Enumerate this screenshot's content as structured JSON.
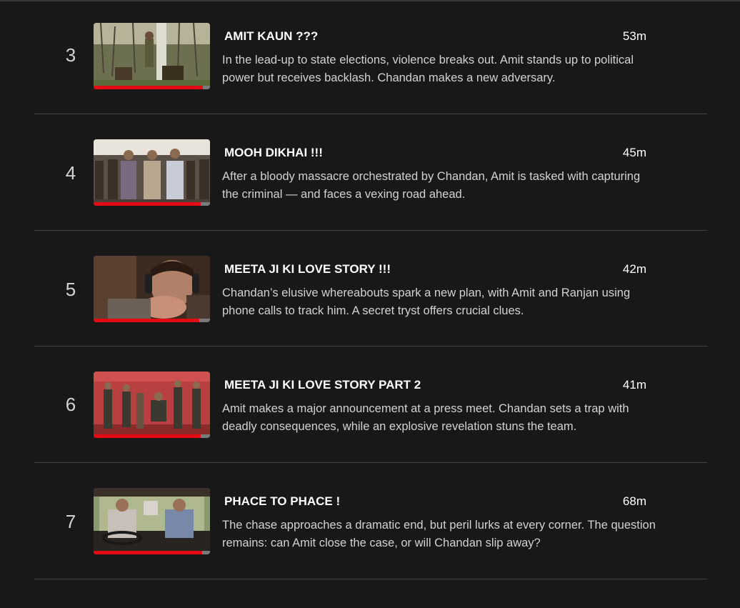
{
  "episodes": [
    {
      "number": "3",
      "title": "AMIT KAUN ???",
      "duration": "53m",
      "description": "In the lead-up to state elections, violence breaks out. Amit stands up to political power but receives backlash. Chandan makes a new adversary.",
      "progress": 0.94,
      "thumb_scene": "forest-pole"
    },
    {
      "number": "4",
      "title": "MOOH DIKHAI !!!",
      "duration": "45m",
      "description": "After a bloody massacre orchestrated by Chandan, Amit is tasked with capturing the criminal — and faces a vexing road ahead.",
      "progress": 0.92,
      "thumb_scene": "crowd-officers"
    },
    {
      "number": "5",
      "title": "MEETA JI KI LOVE STORY !!!",
      "duration": "42m",
      "description": "Chandan’s elusive whereabouts spark a new plan, with Amit and Ranjan using phone calls to track him. A secret tryst offers crucial clues.",
      "progress": 0.91,
      "thumb_scene": "headphones-man"
    },
    {
      "number": "6",
      "title": "MEETA JI KI LOVE STORY PART 2",
      "duration": "41m",
      "description": "Amit makes a major announcement at a press meet. Chandan sets a trap with deadly consequences, while an explosive revelation stuns the team.",
      "progress": 0.92,
      "thumb_scene": "red-stage"
    },
    {
      "number": "7",
      "title": "PHACE TO PHACE !",
      "duration": "68m",
      "description": "The chase approaches a dramatic end, but peril lurks at every corner. The question remains: can Amit close the case, or will Chandan slip away?",
      "progress": 0.93,
      "thumb_scene": "car-drive"
    }
  ],
  "colors": {
    "background": "#181818",
    "progress": "#e50914",
    "divider": "#404040"
  }
}
